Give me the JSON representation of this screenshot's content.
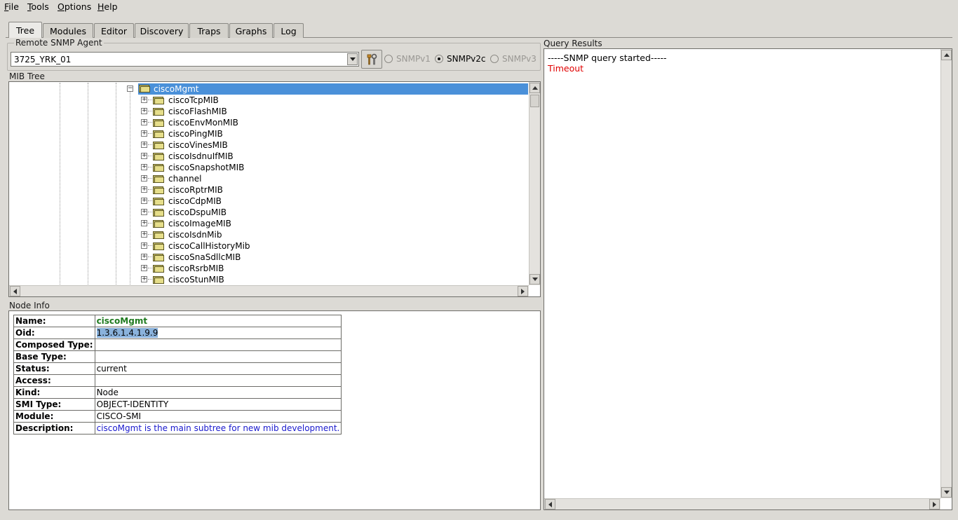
{
  "menu": [
    "File",
    "Tools",
    "Options",
    "Help"
  ],
  "tabs": [
    "Tree",
    "Modules",
    "Editor",
    "Discovery",
    "Traps",
    "Graphs",
    "Log"
  ],
  "active_tab": "Tree",
  "agent": {
    "group_label": "Remote SNMP Agent",
    "selected": "3725_YRK_01",
    "versions": [
      {
        "label": "SNMPv1",
        "enabled": false,
        "checked": false
      },
      {
        "label": "SNMPv2c",
        "enabled": true,
        "checked": true
      },
      {
        "label": "SNMPv3",
        "enabled": false,
        "checked": false
      }
    ]
  },
  "mib_tree": {
    "label": "MIB Tree",
    "selected": "ciscoMgmt",
    "children": [
      "ciscoTcpMIB",
      "ciscoFlashMIB",
      "ciscoEnvMonMIB",
      "ciscoPingMIB",
      "ciscoVinesMIB",
      "ciscoIsdnuIfMIB",
      "ciscoSnapshotMIB",
      "channel",
      "ciscoRptrMIB",
      "ciscoCdpMIB",
      "ciscoDspuMIB",
      "ciscoImageMIB",
      "ciscoIsdnMib",
      "ciscoCallHistoryMib",
      "ciscoSnaSdllcMIB",
      "ciscoRsrbMIB",
      "ciscoStunMIB"
    ]
  },
  "node_info": {
    "label": "Node Info",
    "rows": [
      {
        "key": "Name:",
        "value": "ciscoMgmt"
      },
      {
        "key": "Oid:",
        "value": "1.3.6.1.4.1.9.9"
      },
      {
        "key": "Composed Type:",
        "value": ""
      },
      {
        "key": "Base Type:",
        "value": ""
      },
      {
        "key": "Status:",
        "value": "current"
      },
      {
        "key": "Access:",
        "value": ""
      },
      {
        "key": "Kind:",
        "value": "Node"
      },
      {
        "key": "SMI Type:",
        "value": "OBJECT-IDENTITY"
      },
      {
        "key": "Module:",
        "value": "CISCO-SMI"
      },
      {
        "key": "Description:",
        "value": "ciscoMgmt is the main subtree for new mib development."
      }
    ]
  },
  "query_results": {
    "label": "Query Results",
    "lines": [
      {
        "text": "-----SNMP query started-----",
        "color": "#000000"
      },
      {
        "text": "Timeout",
        "color": "#e00000"
      }
    ]
  },
  "colors": {
    "selection": "#4a90d9",
    "name_green": "#1f7a1f",
    "description_blue": "#1a1acd",
    "error_red": "#e00000"
  }
}
